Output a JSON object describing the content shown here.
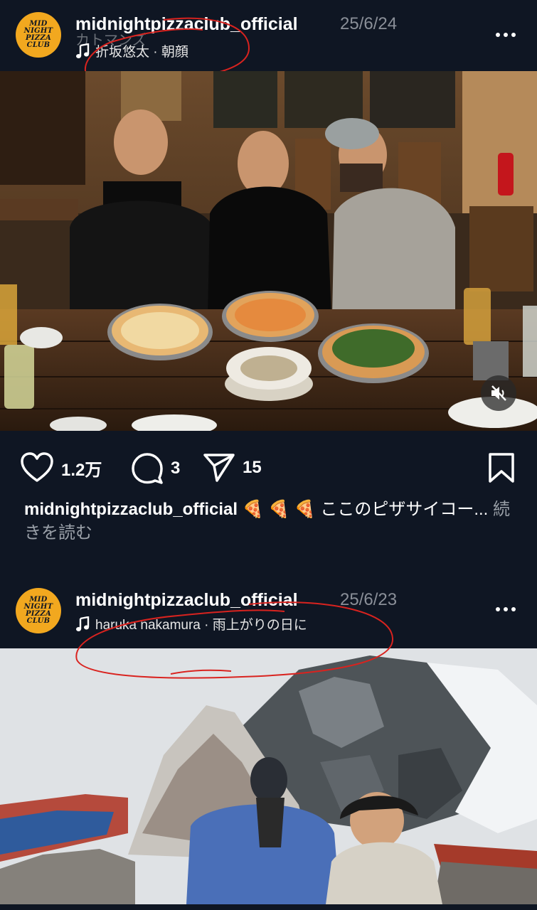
{
  "post1": {
    "avatar_lines": [
      "MID",
      "NIGHT",
      "PIZZA",
      "CLUB"
    ],
    "username": "midnightpizzaclub_official",
    "date": "25/6/24",
    "ghost_text": "カトマンズ",
    "music": "折坂悠太 · 朝顔",
    "likes": "1.2万",
    "comments": "3",
    "shares": "15",
    "caption_user": "midnightpizzaclub_official",
    "caption_emojis": "🍕 🍕 🍕",
    "caption_text": " ここのピザサイコー...",
    "caption_more": "続きを読む"
  },
  "post2": {
    "avatar_lines": [
      "MID",
      "NIGHT",
      "PIZZA",
      "CLUB"
    ],
    "username": "midnightpizzaclub_official",
    "date": "25/6/23",
    "music": "haruka nakamura · 雨上がりの日に"
  },
  "icons": {
    "music": "music-note-icon",
    "more": "more-horizontal-icon",
    "like": "heart-icon",
    "comment": "comment-icon",
    "share": "send-icon",
    "save": "bookmark-icon",
    "mute": "speaker-muted-icon"
  },
  "colors": {
    "background": "#0f1623",
    "avatar": "#f2a81f",
    "annotation": "#d9231f",
    "secondary_text": "#8a8f98"
  }
}
